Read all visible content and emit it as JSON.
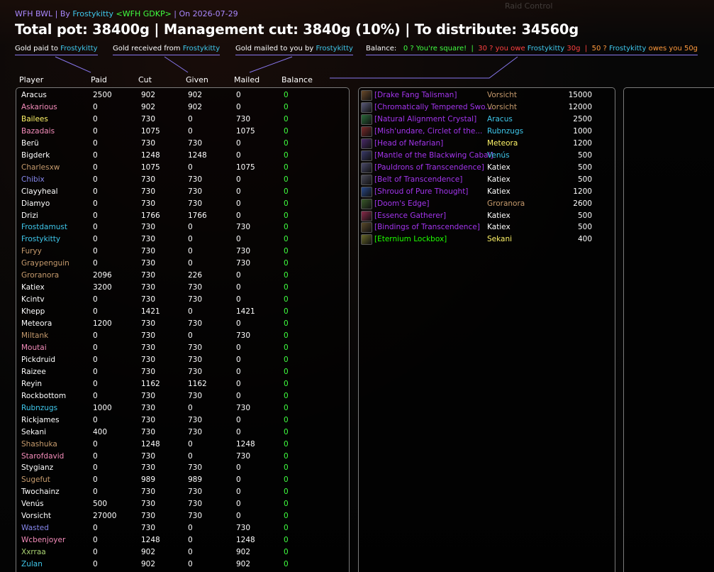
{
  "header": {
    "guild": "WFH BWL",
    "by_prefix": " | By ",
    "author": "Frostykitty",
    "author_tag": " <WFH GDKP>",
    "date_text": " | On 2026-07-29",
    "title": "Total pot: 38400g | Management cut: 3840g (10%) | To distribute: 34560g",
    "ghost_top": "Raid Control"
  },
  "legend": {
    "paid_label": "Gold paid to ",
    "received_label": "Gold received from ",
    "mailed_label": "Gold mailed to you by ",
    "name": "Frostykitty",
    "balance_label": "Balance:",
    "balance_zero": "0 ? You're square!",
    "sep": "|",
    "balance_neg_prefix": "30 ? you owe ",
    "balance_neg_suffix": " 30g",
    "balance_pos_prefix": "50 ? ",
    "balance_pos_suffix": " owes you 50g"
  },
  "columns": {
    "player": "Player",
    "paid": "Paid",
    "cut": "Cut",
    "given": "Given",
    "mailed": "Mailed",
    "balance": "Balance"
  },
  "colors": {
    "warrior": "#c69b6d",
    "paladin": "#f48cba",
    "priest": "#ffffff",
    "rogue": "#fff468",
    "mage": "#3fc7eb",
    "warlock": "#8788ee",
    "shaman": "#4a8fd6",
    "druid": "#ff7c0a",
    "hunter": "#aad372",
    "epic": "#a335ee",
    "uncommon": "#1eff00"
  },
  "players": [
    {
      "name": "Aracus",
      "paid": "2500",
      "cut": "902",
      "given": "902",
      "mailed": "0",
      "balance": "0",
      "color": "#ffffff"
    },
    {
      "name": "Askarious",
      "paid": "0",
      "cut": "902",
      "given": "902",
      "mailed": "0",
      "balance": "0",
      "color": "#f48cba"
    },
    {
      "name": "Bailees",
      "paid": "0",
      "cut": "730",
      "given": "0",
      "mailed": "730",
      "balance": "0",
      "color": "#fff468"
    },
    {
      "name": "Bazadais",
      "paid": "0",
      "cut": "1075",
      "given": "0",
      "mailed": "1075",
      "balance": "0",
      "color": "#f48cba"
    },
    {
      "name": "Berü",
      "paid": "0",
      "cut": "730",
      "given": "730",
      "mailed": "0",
      "balance": "0",
      "color": "#ffffff"
    },
    {
      "name": "Bigderk",
      "paid": "0",
      "cut": "1248",
      "given": "1248",
      "mailed": "0",
      "balance": "0",
      "color": "#ffffff"
    },
    {
      "name": "Charlesxw",
      "paid": "0",
      "cut": "1075",
      "given": "0",
      "mailed": "1075",
      "balance": "0",
      "color": "#c69b6d"
    },
    {
      "name": "Chibix",
      "paid": "0",
      "cut": "730",
      "given": "730",
      "mailed": "0",
      "balance": "0",
      "color": "#8788ee"
    },
    {
      "name": "Clayyheal",
      "paid": "0",
      "cut": "730",
      "given": "730",
      "mailed": "0",
      "balance": "0",
      "color": "#ffffff"
    },
    {
      "name": "Diamyo",
      "paid": "0",
      "cut": "730",
      "given": "730",
      "mailed": "0",
      "balance": "0",
      "color": "#ffffff"
    },
    {
      "name": "Drizi",
      "paid": "0",
      "cut": "1766",
      "given": "1766",
      "mailed": "0",
      "balance": "0",
      "color": "#ffffff"
    },
    {
      "name": "Frostdamust",
      "paid": "0",
      "cut": "730",
      "given": "0",
      "mailed": "730",
      "balance": "0",
      "color": "#3fc7eb"
    },
    {
      "name": "Frostykitty",
      "paid": "0",
      "cut": "730",
      "given": "0",
      "mailed": "0",
      "balance": "0",
      "color": "#3fc7eb"
    },
    {
      "name": "Furyy",
      "paid": "0",
      "cut": "730",
      "given": "0",
      "mailed": "730",
      "balance": "0",
      "color": "#c69b6d"
    },
    {
      "name": "Graypenguin",
      "paid": "0",
      "cut": "730",
      "given": "0",
      "mailed": "730",
      "balance": "0",
      "color": "#c69b6d"
    },
    {
      "name": "Groranora",
      "paid": "2096",
      "cut": "730",
      "given": "226",
      "mailed": "0",
      "balance": "0",
      "color": "#c69b6d"
    },
    {
      "name": "Katiex",
      "paid": "3200",
      "cut": "730",
      "given": "730",
      "mailed": "0",
      "balance": "0",
      "color": "#ffffff"
    },
    {
      "name": "Kcintv",
      "paid": "0",
      "cut": "730",
      "given": "730",
      "mailed": "0",
      "balance": "0",
      "color": "#ffffff"
    },
    {
      "name": "Khepp",
      "paid": "0",
      "cut": "1421",
      "given": "0",
      "mailed": "1421",
      "balance": "0",
      "color": "#ffffff"
    },
    {
      "name": "Meteora",
      "paid": "1200",
      "cut": "730",
      "given": "730",
      "mailed": "0",
      "balance": "0",
      "color": "#ffffff"
    },
    {
      "name": "Miltank",
      "paid": "0",
      "cut": "730",
      "given": "0",
      "mailed": "730",
      "balance": "0",
      "color": "#c69b6d"
    },
    {
      "name": "Moutai",
      "paid": "0",
      "cut": "730",
      "given": "730",
      "mailed": "0",
      "balance": "0",
      "color": "#f48cba"
    },
    {
      "name": "Pickdruid",
      "paid": "0",
      "cut": "730",
      "given": "730",
      "mailed": "0",
      "balance": "0",
      "color": "#ffffff"
    },
    {
      "name": "Raizee",
      "paid": "0",
      "cut": "730",
      "given": "730",
      "mailed": "0",
      "balance": "0",
      "color": "#ffffff"
    },
    {
      "name": "Reyin",
      "paid": "0",
      "cut": "1162",
      "given": "1162",
      "mailed": "0",
      "balance": "0",
      "color": "#ffffff"
    },
    {
      "name": "Rockbottom",
      "paid": "0",
      "cut": "730",
      "given": "730",
      "mailed": "0",
      "balance": "0",
      "color": "#ffffff"
    },
    {
      "name": "Rubnzugs",
      "paid": "1000",
      "cut": "730",
      "given": "0",
      "mailed": "730",
      "balance": "0",
      "color": "#3fc7eb"
    },
    {
      "name": "Rickjames",
      "paid": "0",
      "cut": "730",
      "given": "730",
      "mailed": "0",
      "balance": "0",
      "color": "#ffffff"
    },
    {
      "name": "Sekani",
      "paid": "400",
      "cut": "730",
      "given": "730",
      "mailed": "0",
      "balance": "0",
      "color": "#ffffff"
    },
    {
      "name": "Shashuka",
      "paid": "0",
      "cut": "1248",
      "given": "0",
      "mailed": "1248",
      "balance": "0",
      "color": "#c69b6d"
    },
    {
      "name": "Starofdavid",
      "paid": "0",
      "cut": "730",
      "given": "0",
      "mailed": "730",
      "balance": "0",
      "color": "#f48cba"
    },
    {
      "name": "Stygianz",
      "paid": "0",
      "cut": "730",
      "given": "730",
      "mailed": "0",
      "balance": "0",
      "color": "#ffffff"
    },
    {
      "name": "Sugefut",
      "paid": "0",
      "cut": "989",
      "given": "989",
      "mailed": "0",
      "balance": "0",
      "color": "#c69b6d"
    },
    {
      "name": "Twochainz",
      "paid": "0",
      "cut": "730",
      "given": "730",
      "mailed": "0",
      "balance": "0",
      "color": "#ffffff"
    },
    {
      "name": "Venús",
      "paid": "500",
      "cut": "730",
      "given": "730",
      "mailed": "0",
      "balance": "0",
      "color": "#ffffff"
    },
    {
      "name": "Vorsicht",
      "paid": "27000",
      "cut": "730",
      "given": "730",
      "mailed": "0",
      "balance": "0",
      "color": "#ffffff"
    },
    {
      "name": "Wasted",
      "paid": "0",
      "cut": "730",
      "given": "0",
      "mailed": "730",
      "balance": "0",
      "color": "#8788ee"
    },
    {
      "name": "Wcbenjoyer",
      "paid": "0",
      "cut": "1248",
      "given": "0",
      "mailed": "1248",
      "balance": "0",
      "color": "#f48cba"
    },
    {
      "name": "Xxrraa",
      "paid": "0",
      "cut": "902",
      "given": "0",
      "mailed": "902",
      "balance": "0",
      "color": "#aad372"
    },
    {
      "name": "Zulan",
      "paid": "0",
      "cut": "902",
      "given": "0",
      "mailed": "902",
      "balance": "0",
      "color": "#3fc7eb"
    }
  ],
  "loot": [
    {
      "item": "[Drake Fang Talisman]",
      "winner": "Vorsicht",
      "price": "15000",
      "winner_color": "#c69b6d",
      "quality": "epic",
      "icon_color": "#6a4a2a",
      "icon": "talisman-icon"
    },
    {
      "item": "[Chromatically Tempered Swo...",
      "winner": "Vorsicht",
      "price": "12000",
      "winner_color": "#c69b6d",
      "quality": "epic",
      "icon_color": "#5a5a7a",
      "icon": "sword-icon"
    },
    {
      "item": "[Natural Alignment Crystal]",
      "winner": "Aracus",
      "price": "2500",
      "winner_color": "#3fc7eb",
      "quality": "epic",
      "icon_color": "#2a6a3a",
      "icon": "crystal-icon"
    },
    {
      "item": "[Mish'undare, Circlet of the...",
      "winner": "Rubnzugs",
      "price": "1000",
      "winner_color": "#3fc7eb",
      "quality": "epic",
      "icon_color": "#7a2a2a",
      "icon": "circlet-icon"
    },
    {
      "item": "[Head of Nefarian]",
      "winner": "Meteora",
      "price": "1200",
      "winner_color": "#fff468",
      "quality": "epic",
      "icon_color": "#4a2a6a",
      "icon": "head-icon"
    },
    {
      "item": "[Mantle of the Blackwing Cabal]",
      "winner": "Venús",
      "price": "500",
      "winner_color": "#3fc7eb",
      "quality": "epic",
      "icon_color": "#3a3a6a",
      "icon": "mantle-icon"
    },
    {
      "item": "[Pauldrons of Transcendence]",
      "winner": "Katiex",
      "price": "500",
      "winner_color": "#ffffff",
      "quality": "epic",
      "icon_color": "#4a4a6a",
      "icon": "pauldrons-icon"
    },
    {
      "item": "[Belt of Transcendence]",
      "winner": "Katiex",
      "price": "500",
      "winner_color": "#ffffff",
      "quality": "epic",
      "icon_color": "#4a4a5a",
      "icon": "belt-icon"
    },
    {
      "item": "[Shroud of Pure Thought]",
      "winner": "Katiex",
      "price": "1200",
      "winner_color": "#ffffff",
      "quality": "epic",
      "icon_color": "#2a4a8a",
      "icon": "cloak-icon"
    },
    {
      "item": "[Doom's Edge]",
      "winner": "Groranora",
      "price": "2600",
      "winner_color": "#c69b6d",
      "quality": "epic",
      "icon_color": "#3a5a2a",
      "icon": "axe-icon"
    },
    {
      "item": "[Essence Gatherer]",
      "winner": "Katiex",
      "price": "500",
      "winner_color": "#ffffff",
      "quality": "epic",
      "icon_color": "#8a2a4a",
      "icon": "wand-icon"
    },
    {
      "item": "[Bindings of Transcendence]",
      "winner": "Katiex",
      "price": "500",
      "winner_color": "#ffffff",
      "quality": "epic",
      "icon_color": "#5a4a2a",
      "icon": "bracer-icon"
    },
    {
      "item": "[Eternium Lockbox]",
      "winner": "Sekani",
      "price": "400",
      "winner_color": "#fff468",
      "quality": "uncommon",
      "icon_color": "#6a6a2a",
      "icon": "lockbox-icon"
    }
  ]
}
